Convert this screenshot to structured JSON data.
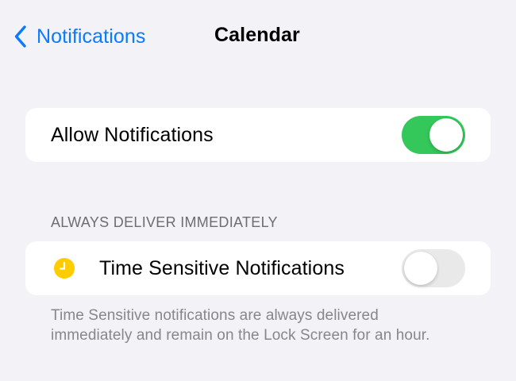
{
  "nav": {
    "back_label": "Notifications",
    "title": "Calendar"
  },
  "allow_notifications": {
    "label": "Allow Notifications",
    "enabled": true
  },
  "section": {
    "header": "ALWAYS DELIVER IMMEDIATELY",
    "time_sensitive": {
      "label": "Time Sensitive Notifications",
      "icon": "clock-icon",
      "enabled": false
    },
    "footer": "Time Sensitive notifications are always delivered immediately and remain on the Lock Screen for an hour."
  },
  "colors": {
    "accent": "#0a7aff",
    "toggle_on": "#34c759",
    "toggle_off": "#e9e9ea",
    "clock_icon": "#ffcc00",
    "background": "#f2f2f7"
  }
}
